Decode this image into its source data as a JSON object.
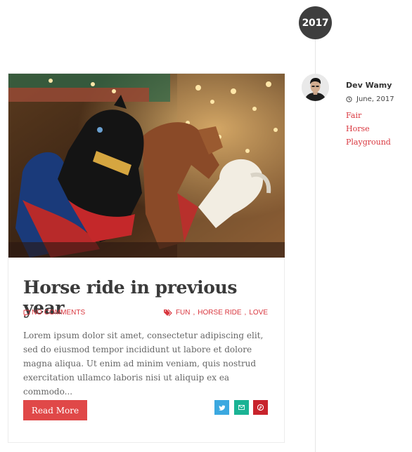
{
  "timeline": {
    "year": "2017"
  },
  "post": {
    "title": "Horse ride in previous year",
    "comments": "NO COMMENTS",
    "tags": [
      "FUN",
      "HORSE RIDE",
      "LOVE"
    ],
    "excerpt": "Lorem ipsum dolor sit amet, consectetur adipiscing elit, sed do eiusmod tempor incididunt ut labore et dolore magna aliqua. Ut enim ad minim veniam, quis nostrud exercitation ullamco laboris nisi ut aliquip ex ea commodo...",
    "read_more_label": "Read More"
  },
  "share": {
    "icons": [
      "twitter-icon",
      "email-icon",
      "pinterest-icon"
    ],
    "colors": {
      "twitter": "#3ba8e0",
      "email": "#1ab394",
      "pinterest": "#c8232c"
    }
  },
  "author": {
    "name": "Dev Wamy",
    "date": "June, 2017",
    "categories": [
      "Fair",
      "Horse",
      "Playground"
    ]
  },
  "colors": {
    "accent": "#d9363e",
    "button": "#e04848",
    "badge": "#3e3e3e"
  }
}
